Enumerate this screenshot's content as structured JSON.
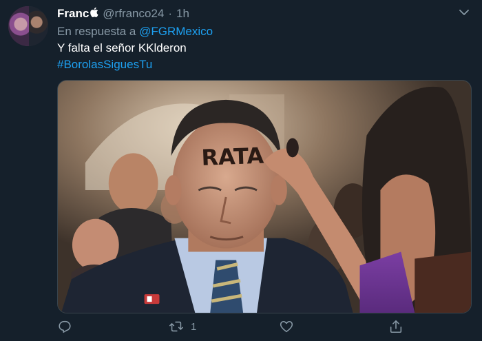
{
  "tweet": {
    "display_name": "Franc",
    "handle": "@rfranco24",
    "separator": "·",
    "time": "1h",
    "reply_prefix": "En respuesta a",
    "reply_to": "@FGRMexico",
    "text": "Y falta el señor KKlderon",
    "hashtag": "#BorolasSiguesTu",
    "photo_forehead_text": "RATA",
    "actions": {
      "reply_count": "",
      "retweet_count": "1",
      "like_count": "",
      "share_count": ""
    }
  },
  "icons": [
    "apple-icon",
    "chevron-down-icon",
    "reply-icon",
    "retweet-icon",
    "like-icon",
    "share-icon"
  ],
  "colors": {
    "background": "#15202b",
    "secondary_text": "#8899a6",
    "link": "#1da1f2"
  }
}
